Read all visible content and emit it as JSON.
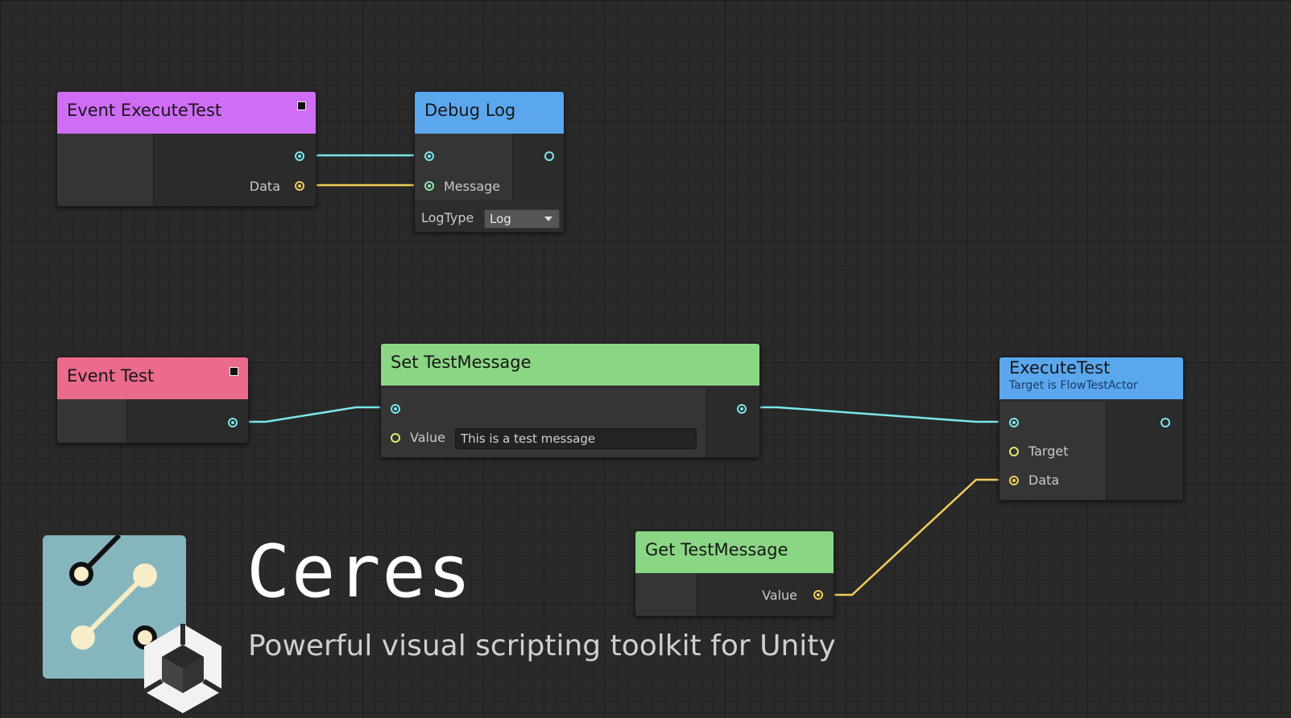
{
  "nodes": {
    "event_execute_test": {
      "title": "Event ExecuteTest",
      "data_label": "Data",
      "color": "#cf6df5"
    },
    "debug_log": {
      "title": "Debug Log",
      "message_label": "Message",
      "logtype_label": "LogType",
      "logtype_value": "Log",
      "color": "#5ba7ee"
    },
    "event_test": {
      "title": "Event Test",
      "color": "#ea6b8c"
    },
    "set_test_message": {
      "title": "Set TestMessage",
      "value_label": "Value",
      "value_text": "This is a test message",
      "color": "#8ad684"
    },
    "execute_test": {
      "title": "ExecuteTest",
      "subtitle": "Target is FlowTestActor",
      "target_label": "Target",
      "data_label": "Data",
      "color": "#5ba7ee"
    },
    "get_test_message": {
      "title": "Get TestMessage",
      "value_label": "Value",
      "color": "#8ad684"
    }
  },
  "branding": {
    "title": "Ceres",
    "tagline": "Powerful visual scripting toolkit for Unity",
    "logo_icon": "ceres-graph-logo-icon",
    "unity_icon": "unity-cube-icon"
  },
  "colors": {
    "exec_wire": "#7ce6ee",
    "data_wire": "#f2cd5c",
    "logo_background": "#86b6bd"
  }
}
